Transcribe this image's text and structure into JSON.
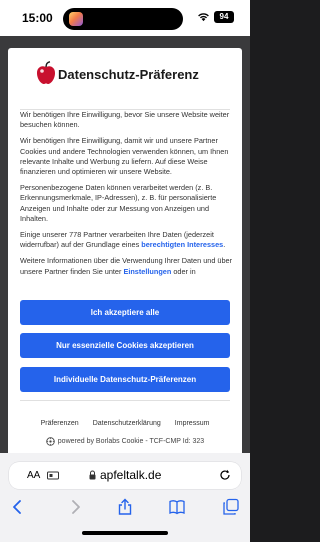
{
  "status_bar": {
    "time": "15:00",
    "battery": "94"
  },
  "dialog": {
    "title": "Datenschutz-Präferenz",
    "paragraphs": {
      "p1": "Wir benötigen Ihre Einwilligung, bevor Sie unsere Website weiter besuchen können.",
      "p2": "Wir benötigen Ihre Einwilligung, damit wir und unsere Partner Cookies und andere Technologien verwenden können, um Ihnen relevante Inhalte und Werbung zu liefern. Auf diese Weise finanzieren und optimieren wir unsere Website.",
      "p3": "Personenbezogene Daten können verarbeitet werden (z. B. Erkennungsmerkmale, IP-Adressen), z. B. für personalisierte Anzeigen und Inhalte oder zur Messung von Anzeigen und Inhalten.",
      "p4_pre": "Einige unserer 778 Partner verarbeiten Ihre Daten (jederzeit widerrufbar) auf der Grundlage eines",
      "p4_link": "berechtigten Interesses",
      "p4_post": ".",
      "p5_pre": "Weitere Informationen über die Verwendung Ihrer Daten und über unsere Partner finden Sie unter",
      "p5_link": "Einstellungen",
      "p5_post": "oder in"
    },
    "buttons": {
      "accept_all": "Ich akzeptiere alle",
      "essential_only": "Nur essenzielle Cookies akzeptieren",
      "individual": "Individuelle Datenschutz-Präferenzen"
    },
    "footer_links": {
      "preferences": "Präferenzen",
      "privacy_statement": "Datenschutzerklärung",
      "imprint": "Impressum"
    }
  },
  "powered_by": "powered by Borlabs Cookie - TCF-CMP Id: 323",
  "safari": {
    "aa_label": "AA",
    "url": "apfeltalk.de"
  },
  "colors": {
    "accent_blue": "#2563eb",
    "logo_red": "#c8102e"
  },
  "icons": {
    "wifi": "wifi-icon",
    "logo": "apple-logo-icon",
    "lock": "lock-icon",
    "reload": "reload-icon",
    "back": "chevron-left-icon",
    "forward": "chevron-right-icon",
    "share": "share-icon",
    "bookmarks": "book-icon",
    "tabs": "tabs-icon",
    "extension": "extension-icon"
  }
}
